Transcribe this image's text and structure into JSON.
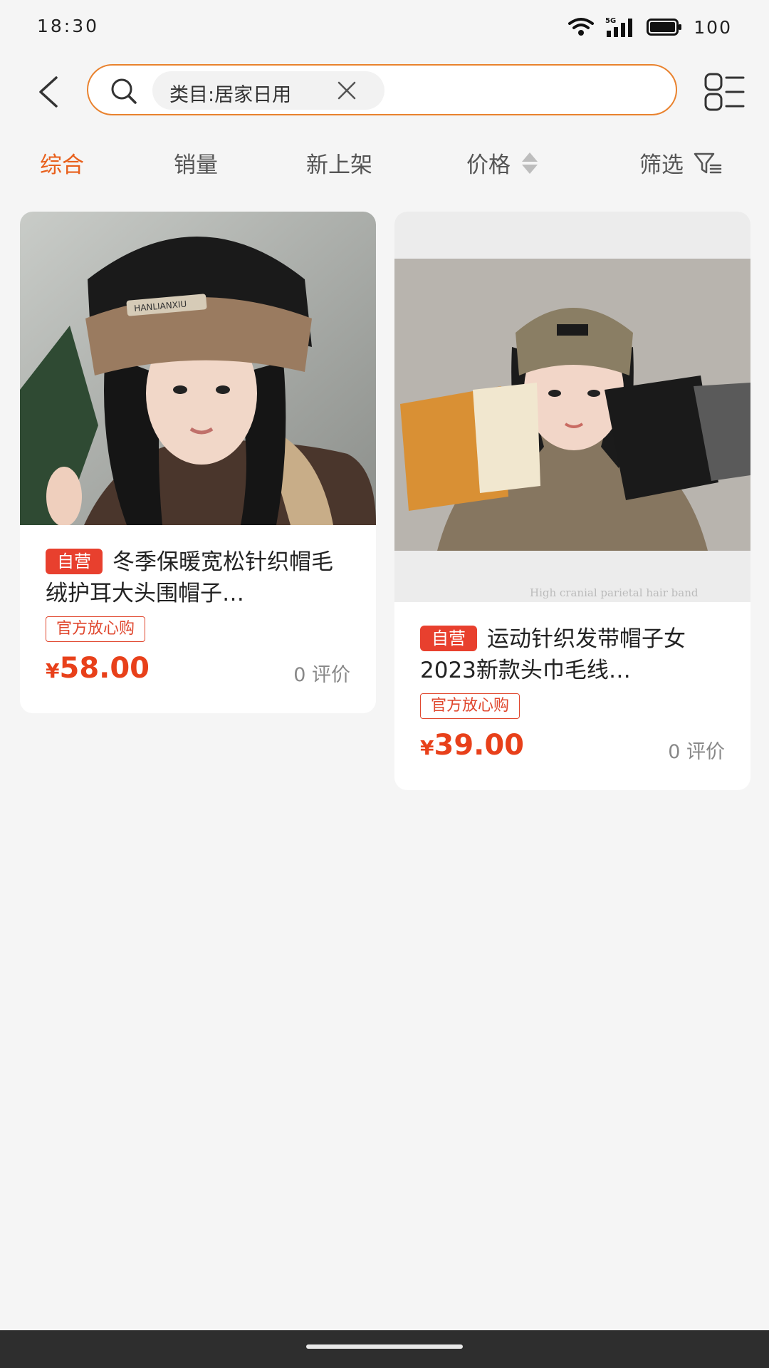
{
  "status_bar": {
    "time": "18:30",
    "network": "5G",
    "battery": "100"
  },
  "header": {
    "back_icon": "chevron-left-icon",
    "search": {
      "chip_label": "类目:居家日用",
      "icon": "search-icon",
      "clear_icon": "close-icon"
    },
    "layout_icon": "list-layout-icon"
  },
  "sort_bar": {
    "items": [
      {
        "label": "综合",
        "active": true
      },
      {
        "label": "销量",
        "active": false
      },
      {
        "label": "新上架",
        "active": false
      },
      {
        "label": "价格",
        "active": false,
        "icon": "sort-arrows-icon"
      },
      {
        "label": "筛选",
        "active": false,
        "icon": "filter-icon"
      }
    ]
  },
  "products": [
    {
      "tag": "自营",
      "title": "冬季保暖宽松针织帽毛绒护耳大头围帽子…",
      "badge": "官方放心购",
      "currency": "¥",
      "price": "58.00",
      "reviews": "0 评价",
      "image_text": "HANLIANXIU"
    },
    {
      "tag": "自营",
      "title": "运动针织发带帽子女2023新款头巾毛线…",
      "badge": "官方放心购",
      "currency": "¥",
      "price": "39.00",
      "reviews": "0 评价",
      "image_text": "High cranial parietal hair band"
    }
  ],
  "colors": {
    "accent": "#e8601c",
    "price": "#e8401a",
    "tag": "#e8402e",
    "search_border": "#e9822e"
  }
}
